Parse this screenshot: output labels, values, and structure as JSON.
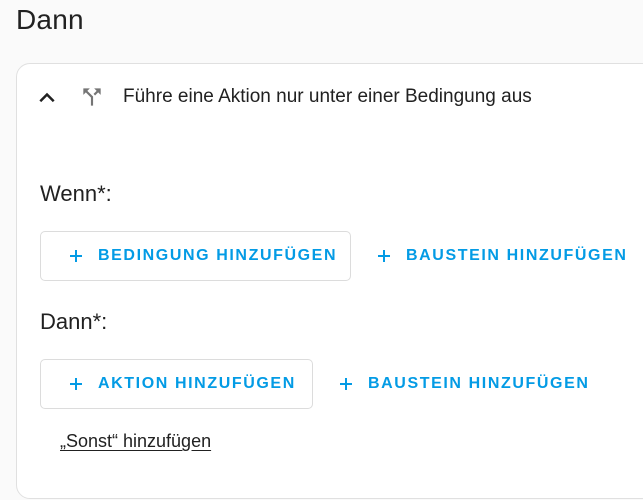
{
  "page": {
    "title": "Dann"
  },
  "card": {
    "header_title": "Führe eine Aktion nur unter einer Bedingung aus",
    "icons": {
      "collapse": "chevron-up-icon",
      "type": "call-split-icon"
    },
    "if_section": {
      "label": "Wenn*:",
      "buttons": [
        {
          "label": "Bedingung hinzufügen",
          "icon": "plus-icon",
          "style": "outlined"
        },
        {
          "label": "Baustein hinzufügen",
          "icon": "plus-icon",
          "style": "text"
        }
      ]
    },
    "then_section": {
      "label": "Dann*:",
      "buttons": [
        {
          "label": "Aktion hinzufügen",
          "icon": "plus-icon",
          "style": "outlined"
        },
        {
          "label": "Baustein hinzufügen",
          "icon": "plus-icon",
          "style": "text"
        }
      ]
    },
    "else_link": "„Sonst“ hinzufügen"
  },
  "colors": {
    "accent": "#039be5",
    "text": "#212121",
    "border": "#e0e0e0",
    "background": "#fafafa"
  }
}
